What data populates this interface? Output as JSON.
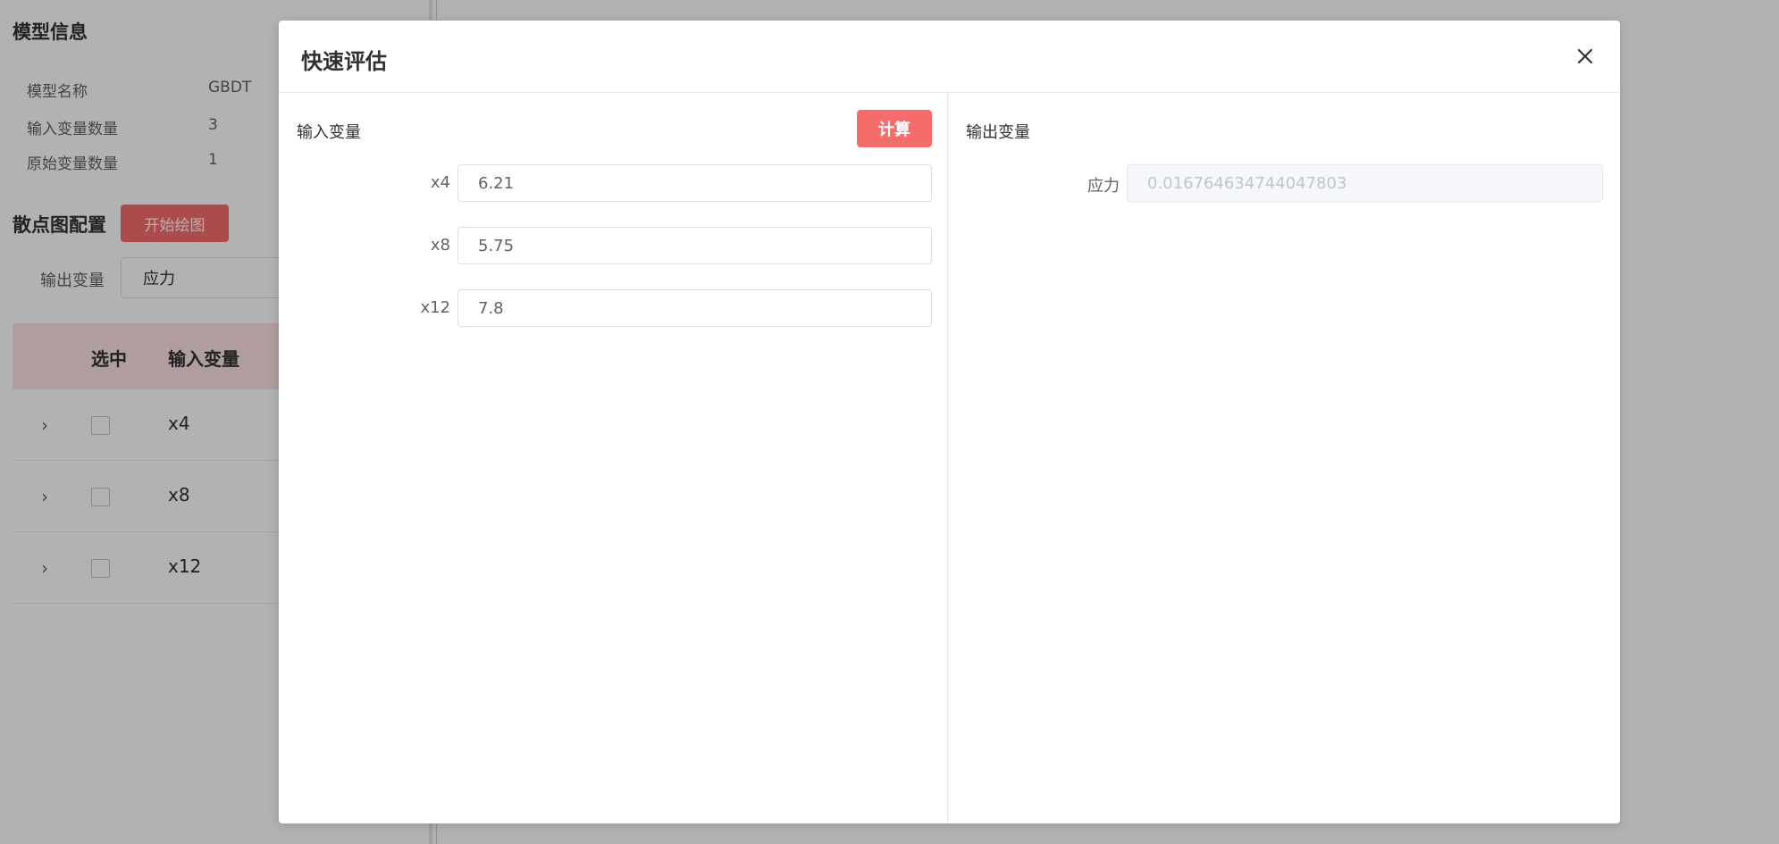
{
  "background": {
    "model_info": {
      "title": "模型信息",
      "rows": [
        {
          "label": "模型名称",
          "value": "GBDT"
        },
        {
          "label": "输入变量数量",
          "value": "3"
        },
        {
          "label": "原始变量数量",
          "value": "1"
        }
      ]
    },
    "scatter_config": {
      "title": "散点图配置",
      "start_button": "开始绘图",
      "output_label": "输出变量",
      "output_value": "应力"
    },
    "table": {
      "headers": [
        "选中",
        "输入变量"
      ],
      "rows": [
        {
          "name": "x4"
        },
        {
          "name": "x8"
        },
        {
          "name": "x12"
        }
      ]
    }
  },
  "dialog": {
    "title": "快速评估",
    "inputs": {
      "title": "输入变量",
      "calc_button": "计算",
      "fields": [
        {
          "label": "x4",
          "value": "6.21"
        },
        {
          "label": "x8",
          "value": "5.75"
        },
        {
          "label": "x12",
          "value": "7.8"
        }
      ]
    },
    "outputs": {
      "title": "输出变量",
      "fields": [
        {
          "label": "应力",
          "value": "0.016764634744047803"
        }
      ]
    }
  }
}
